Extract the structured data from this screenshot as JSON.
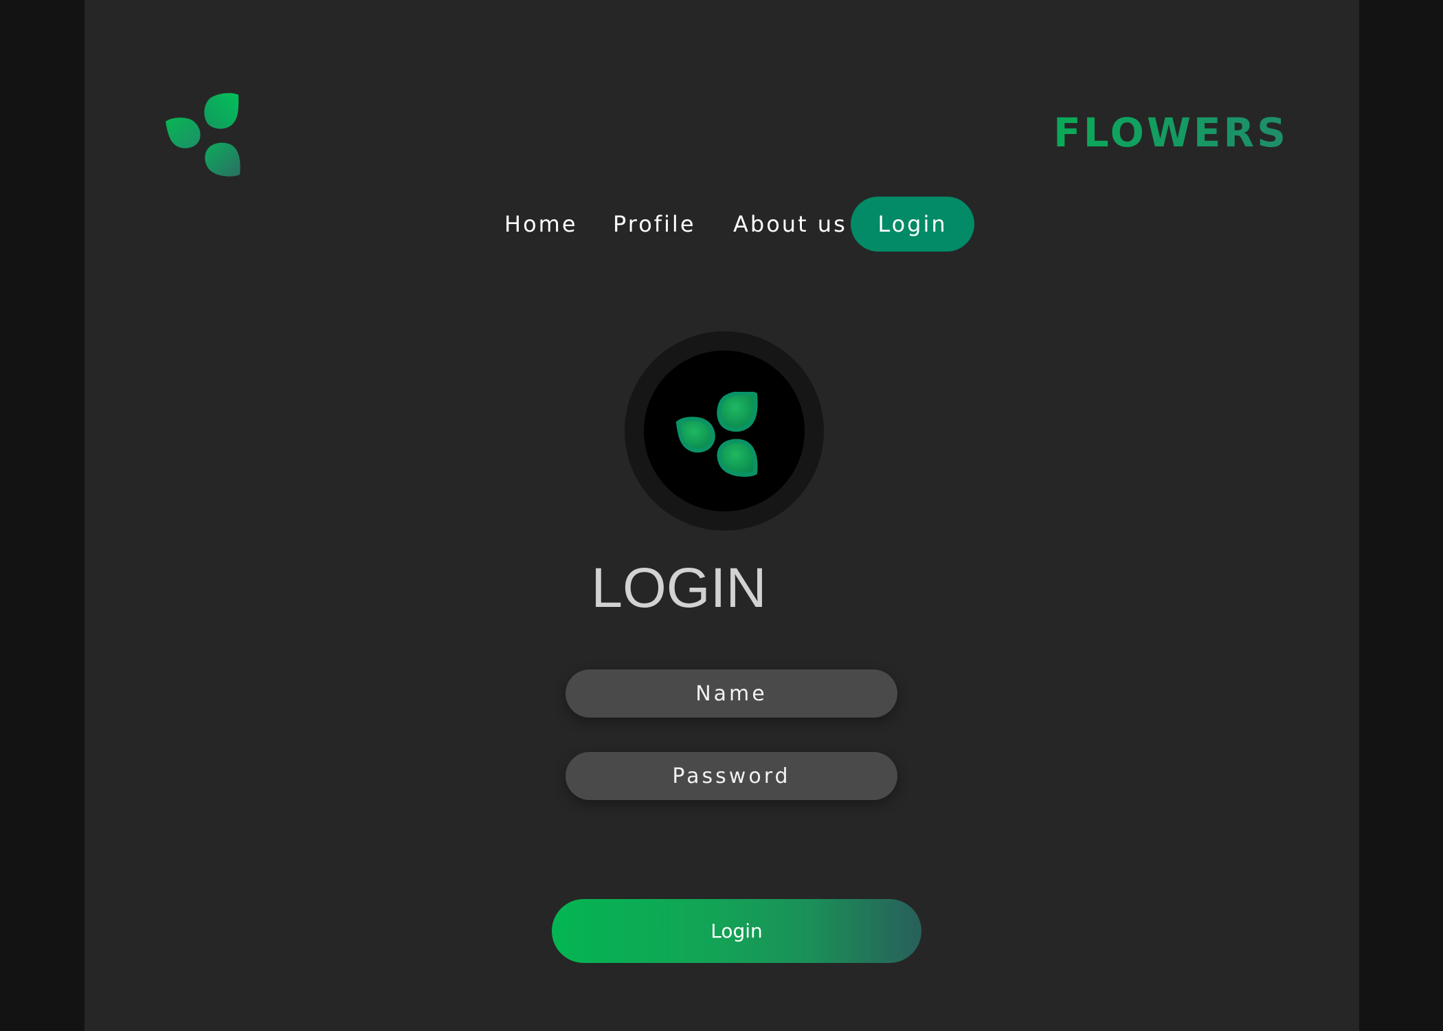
{
  "brand": {
    "name": "FLOWERS",
    "logo_icon": "three-petal-leaf-icon",
    "accent_color": "#0aaa58"
  },
  "nav": {
    "items": [
      {
        "label": "Home"
      },
      {
        "label": "Profile"
      },
      {
        "label": "About us"
      },
      {
        "label": "Login",
        "active": true
      }
    ],
    "active_color": "#038a66"
  },
  "login": {
    "avatar_icon": "three-petal-leaf-icon",
    "title": "LOGIN",
    "name_placeholder": "Name",
    "password_placeholder": "Password",
    "submit_label": "Login"
  }
}
